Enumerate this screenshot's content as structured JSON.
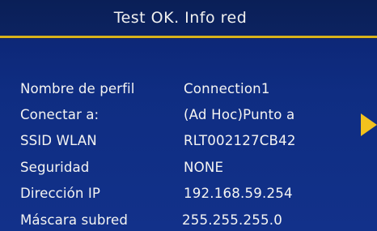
{
  "window": {
    "title": "Test OK. Info red"
  },
  "info": [
    {
      "label": "Nombre de perfil",
      "value": "Connection1"
    },
    {
      "label": "Conectar a:",
      "value": "(Ad Hoc)Punto a"
    },
    {
      "label": "SSID WLAN",
      "value": "RLT002127CB42"
    },
    {
      "label": "Seguridad",
      "value": "NONE"
    },
    {
      "label": "Dirección IP",
      "value": "192.168.59.254"
    },
    {
      "label": "Máscara subred",
      "value": "255.255.255.0"
    }
  ],
  "icons": {
    "next": "chevron-right-icon"
  },
  "colors": {
    "background": "#12318a",
    "accent": "#d9b21a",
    "arrow": "#f2c21e",
    "text": "#f4f4f2"
  }
}
